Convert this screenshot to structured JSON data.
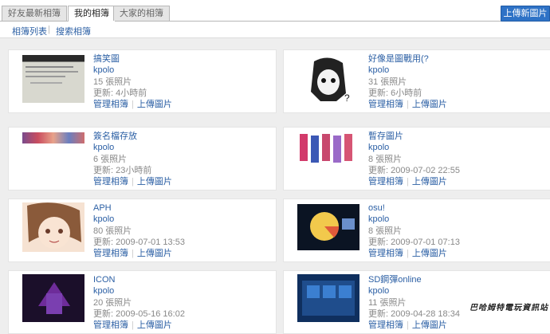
{
  "tabs": [
    "好友最新相簿",
    "我的相簿",
    "大家的相簿"
  ],
  "upload_button": "上傳新圖片",
  "subnav": [
    "相簿列表",
    "搜索相簿"
  ],
  "albums": [
    {
      "title": "搞笑圖",
      "owner": "kpolo",
      "count": "15 張照片",
      "updated": "更新: 4小時前",
      "manage": "管理相簿",
      "upload": "上傳圖片"
    },
    {
      "title": "好像是圖戰用(?",
      "owner": "kpolo",
      "count": "31 張照片",
      "updated": "更新: 6小時前",
      "manage": "管理相簿",
      "upload": "上傳圖片"
    },
    {
      "title": "簽名檔存放",
      "owner": "kpolo",
      "count": "6 張照片",
      "updated": "更新: 23小時前",
      "manage": "管理相簿",
      "upload": "上傳圖片"
    },
    {
      "title": "暫存圖片",
      "owner": "kpolo",
      "count": "8 張照片",
      "updated": "更新: 2009-07-02 22:55",
      "manage": "管理相簿",
      "upload": "上傳圖片"
    },
    {
      "title": "APH",
      "owner": "kpolo",
      "count": "80 張照片",
      "updated": "更新: 2009-07-01 13:53",
      "manage": "管理相簿",
      "upload": "上傳圖片"
    },
    {
      "title": "osu!",
      "owner": "kpolo",
      "count": "8 張照片",
      "updated": "更新: 2009-07-01 07:13",
      "manage": "管理相簿",
      "upload": "上傳圖片"
    },
    {
      "title": "ICON",
      "owner": "kpolo",
      "count": "20 張照片",
      "updated": "更新: 2009-05-16 16:02",
      "manage": "管理相簿",
      "upload": "上傳圖片"
    },
    {
      "title": "SD鋼彈online",
      "owner": "kpolo",
      "count": "11 張照片",
      "updated": "更新: 2009-04-28 18:34",
      "manage": "管理相簿",
      "upload": "上傳圖片"
    }
  ],
  "watermark": "巴哈姆特電玩資訊站"
}
